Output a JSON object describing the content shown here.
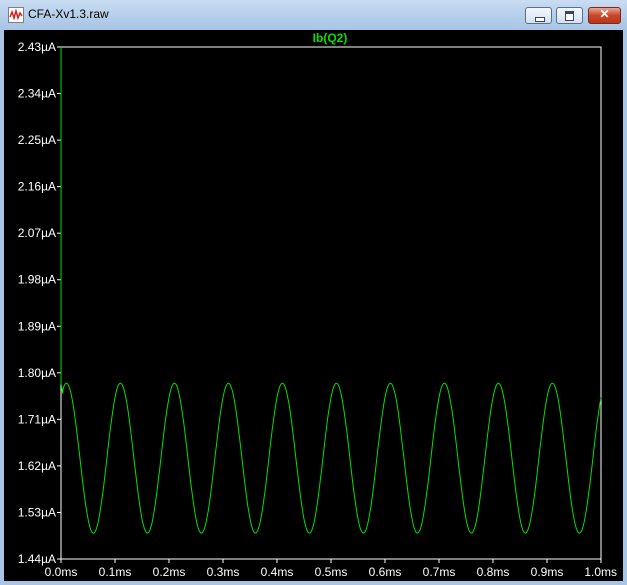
{
  "window": {
    "title": "CFA-Xv1.3.raw",
    "icon": "waveform-icon",
    "buttons": [
      "minimize",
      "maximize",
      "close"
    ]
  },
  "colors": {
    "plot_background": "#000000",
    "trace": "#00e000",
    "axis": "#ffffff",
    "frame": "#ffffff"
  },
  "chart_data": {
    "type": "line",
    "title": "Ib(Q2)",
    "xlabel": "",
    "ylabel": "",
    "xlim": [
      0,
      1.0
    ],
    "ylim": [
      1.44,
      2.43
    ],
    "x_unit": "ms",
    "y_unit": "µA",
    "x_ticks": [
      "0.0ms",
      "0.1ms",
      "0.2ms",
      "0.3ms",
      "0.4ms",
      "0.5ms",
      "0.6ms",
      "0.7ms",
      "0.8ms",
      "0.9ms",
      "1.0ms"
    ],
    "y_ticks": [
      "2.43µA",
      "2.34µA",
      "2.25µA",
      "2.16µA",
      "2.07µA",
      "1.98µA",
      "1.89µA",
      "1.80µA",
      "1.71µA",
      "1.62µA",
      "1.53µA",
      "1.44µA"
    ],
    "grid": false,
    "series": [
      {
        "name": "Ib(Q2)",
        "description_values": {
          "initial_transient_start": 2.43,
          "max": 1.78,
          "min": 1.49,
          "period_ms": 0.1,
          "first_peak_ms": 0.01
        },
        "x": [
          0.0,
          0.002,
          0.004,
          0.01,
          0.035,
          0.06,
          0.085,
          0.11,
          0.135,
          0.16,
          0.185,
          0.21,
          0.235,
          0.26,
          0.285,
          0.31,
          0.335,
          0.36,
          0.385,
          0.41,
          0.435,
          0.46,
          0.485,
          0.51,
          0.535,
          0.56,
          0.585,
          0.61,
          0.635,
          0.66,
          0.685,
          0.71,
          0.735,
          0.76,
          0.785,
          0.81,
          0.835,
          0.86,
          0.885,
          0.91,
          0.935,
          0.96,
          0.985,
          1.0
        ],
        "y": [
          2.43,
          1.8,
          1.76,
          1.78,
          1.635,
          1.49,
          1.635,
          1.78,
          1.635,
          1.49,
          1.635,
          1.78,
          1.635,
          1.49,
          1.635,
          1.78,
          1.635,
          1.49,
          1.635,
          1.78,
          1.635,
          1.49,
          1.635,
          1.78,
          1.635,
          1.49,
          1.635,
          1.78,
          1.635,
          1.49,
          1.635,
          1.78,
          1.635,
          1.49,
          1.635,
          1.78,
          1.635,
          1.49,
          1.635,
          1.78,
          1.635,
          1.49,
          1.635,
          1.75
        ]
      }
    ]
  }
}
